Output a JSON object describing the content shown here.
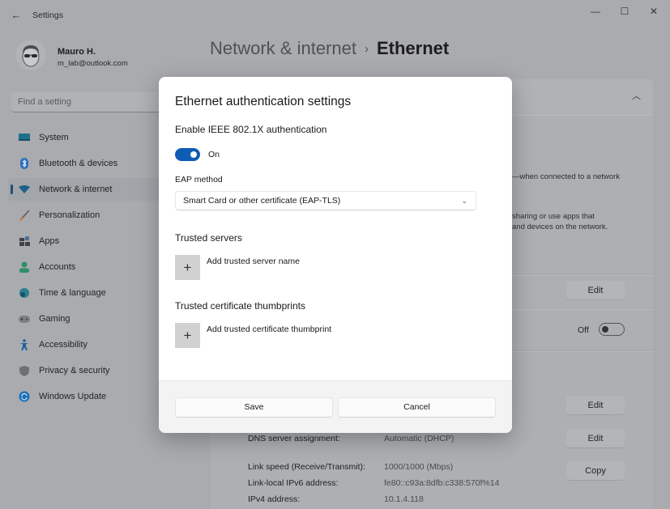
{
  "window": {
    "app_title": "Settings",
    "controls": {
      "minimize": "—",
      "maximize": "☐",
      "close": "✕"
    }
  },
  "profile": {
    "name": "Mauro H.",
    "email": "m_lab@outlook.com"
  },
  "search": {
    "placeholder": "Find a setting"
  },
  "sidebar": {
    "items": [
      {
        "label": "System",
        "icon": "monitor-icon",
        "active": false
      },
      {
        "label": "Bluetooth & devices",
        "icon": "bluetooth-icon",
        "active": false
      },
      {
        "label": "Network & internet",
        "icon": "wifi-icon",
        "active": true
      },
      {
        "label": "Personalization",
        "icon": "brush-icon",
        "active": false
      },
      {
        "label": "Apps",
        "icon": "apps-icon",
        "active": false
      },
      {
        "label": "Accounts",
        "icon": "person-icon",
        "active": false
      },
      {
        "label": "Time & language",
        "icon": "globe-clock-icon",
        "active": false
      },
      {
        "label": "Gaming",
        "icon": "gamepad-icon",
        "active": false
      },
      {
        "label": "Accessibility",
        "icon": "accessibility-icon",
        "active": false
      },
      {
        "label": "Privacy & security",
        "icon": "shield-icon",
        "active": false
      },
      {
        "label": "Windows Update",
        "icon": "update-icon",
        "active": false
      }
    ]
  },
  "breadcrumb": {
    "parent": "Network & internet",
    "separator": "›",
    "current": "Ethernet"
  },
  "background": {
    "metered_text": "—when connected to a network",
    "sharing_text_1": "sharing or use apps that",
    "sharing_text_2": "and devices on the network.",
    "edit_label": "Edit",
    "copy_label": "Copy",
    "toggle_off_label": "Off",
    "info": [
      {
        "label": "DNS server assignment:",
        "value": "Automatic (DHCP)"
      },
      {
        "label": "Link speed (Receive/Transmit):",
        "value": "1000/1000 (Mbps)"
      },
      {
        "label": "Link-local IPv6 address:",
        "value": "fe80::c93a:8dfb:c338:570f%14"
      },
      {
        "label": "IPv4 address:",
        "value": "10.1.4.118"
      }
    ]
  },
  "dialog": {
    "title": "Ethernet authentication settings",
    "enable_label": "Enable IEEE 802.1X authentication",
    "toggle_state": "On",
    "eap_label": "EAP method",
    "eap_value": "Smart Card or other certificate (EAP-TLS)",
    "trusted_servers_label": "Trusted servers",
    "add_server_label": "Add trusted server name",
    "thumbprints_label": "Trusted certificate thumbprints",
    "add_thumbprint_label": "Add trusted certificate thumbprint",
    "save_label": "Save",
    "cancel_label": "Cancel"
  }
}
